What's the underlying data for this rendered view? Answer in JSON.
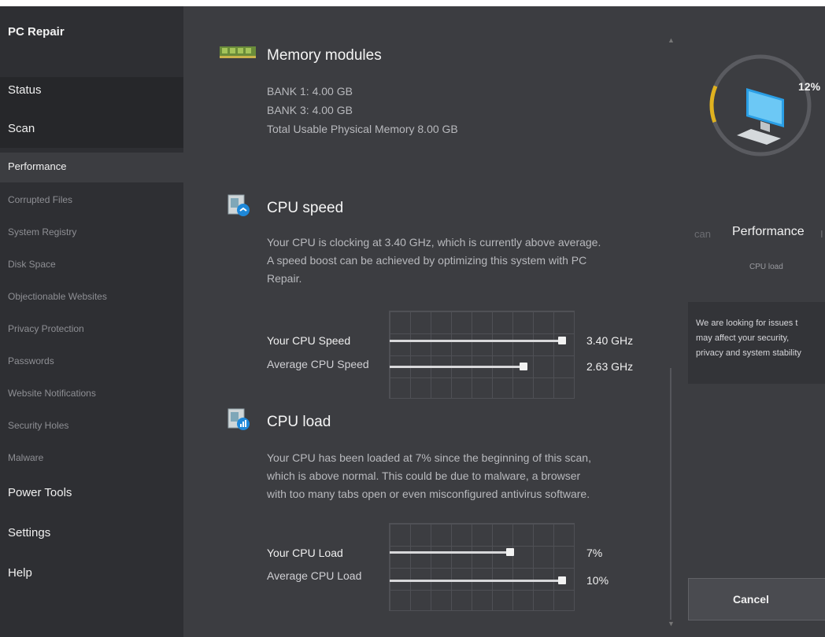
{
  "app": {
    "title": "PC Repair"
  },
  "sidebar": {
    "items": [
      {
        "label": "Status"
      },
      {
        "label": "Scan"
      },
      {
        "label": "Performance"
      },
      {
        "label": "Corrupted Files"
      },
      {
        "label": "System Registry"
      },
      {
        "label": "Disk Space"
      },
      {
        "label": "Objectionable Websites"
      },
      {
        "label": "Privacy Protection"
      },
      {
        "label": "Passwords"
      },
      {
        "label": "Website Notifications"
      },
      {
        "label": "Security Holes"
      },
      {
        "label": "Malware"
      },
      {
        "label": "Power Tools"
      },
      {
        "label": "Settings"
      },
      {
        "label": "Help"
      }
    ]
  },
  "memory": {
    "title": "Memory modules",
    "lines": [
      "BANK 1: 4.00 GB",
      "BANK 3: 4.00 GB",
      "Total Usable Physical Memory 8.00 GB"
    ],
    "icon": "memory-module-icon"
  },
  "cpu_speed": {
    "title": "CPU speed",
    "icon": "cpu-speed-icon",
    "paragraph": [
      "Your CPU is clocking at 3.40 GHz, which is currently above average.",
      "A speed boost can be achieved by optimizing this system with PC",
      "Repair."
    ],
    "bars": [
      {
        "label": "Your CPU Speed",
        "value": "3.40 GHz",
        "fraction": 0.93
      },
      {
        "label": "Average CPU Speed",
        "value": "2.63 GHz",
        "fraction": 0.72
      }
    ]
  },
  "cpu_load": {
    "title": "CPU load",
    "icon": "cpu-load-icon",
    "paragraph": [
      "Your CPU has been loaded at 7% since the beginning of this scan,",
      "which is above normal. This could be due to malware, a browser",
      "with too many tabs open or even misconfigured antivirus software."
    ],
    "bars": [
      {
        "label": "Your CPU Load",
        "value": "7%",
        "fraction": 0.65
      },
      {
        "label": "Average CPU Load",
        "value": "10%",
        "fraction": 0.93
      }
    ]
  },
  "right_panel": {
    "progress_text": "12%",
    "progress_fraction": 0.12,
    "tab_prev": "can",
    "tab_current": "Performance",
    "tab_next": "I",
    "tab_sub": "CPU load",
    "info": [
      "We are looking for issues t",
      "may affect your security,",
      "privacy and system stability"
    ],
    "cancel_label": "Cancel",
    "accent_color": "#e0b21f",
    "monitor_icon": "computer-monitor-icon"
  }
}
